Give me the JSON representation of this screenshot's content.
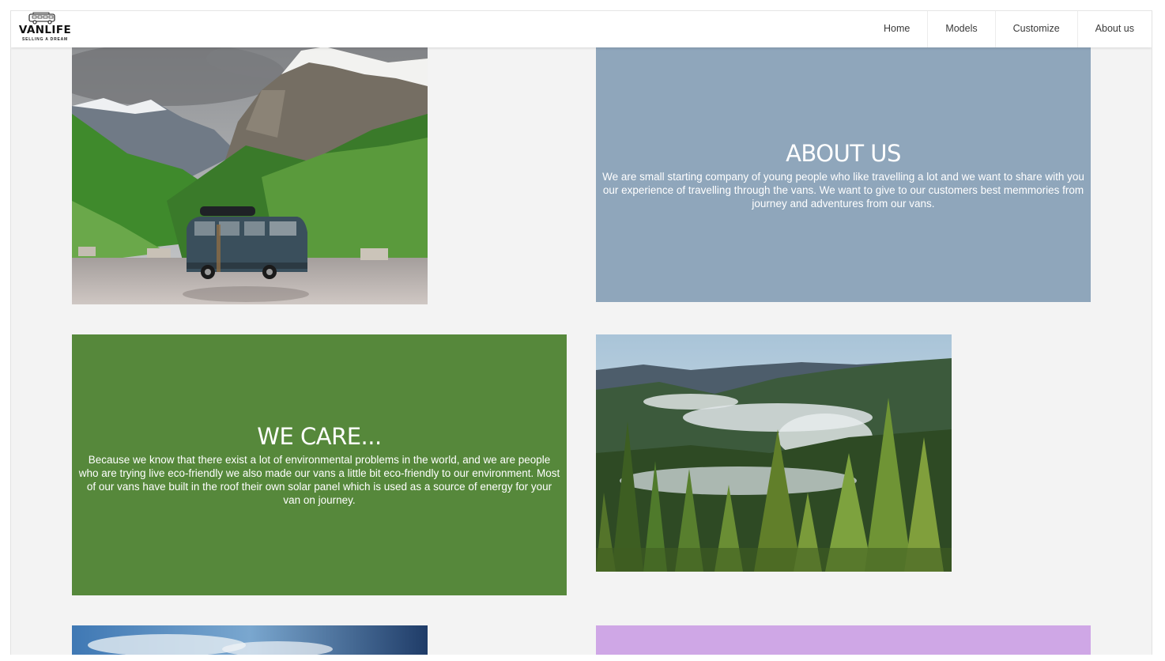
{
  "brand": {
    "name": "VANLIFE",
    "tagline": "SELLING A DREAM",
    "icon": "van-icon"
  },
  "nav": {
    "items": [
      {
        "label": "Home"
      },
      {
        "label": "Models"
      },
      {
        "label": "Customize"
      },
      {
        "label": "About us"
      }
    ]
  },
  "sections": {
    "about": {
      "title": "ABOUT US",
      "body": "We are small starting company of young people who like travelling a lot and we want to share with you our experience of travelling through the vans. We want to give to our customers best memmories from journey and adventures from our vans.",
      "background": "#8fa6bb"
    },
    "care": {
      "title": "WE CARE...",
      "body": "Because we know that there exist a lot of environmental problems in the world, and we are people who are trying live eco-friendly we also made our vans a little bit eco-friendly to our environment. Most of our vans have built in the roof their own solar panel which is used as a source of energy for your van on journey.",
      "background": "#56883b"
    },
    "third": {
      "background": "#cfa7e6"
    }
  },
  "colors": {
    "page_background": "#f3f3f3",
    "navbar_background": "#ffffff",
    "text_on_tiles": "#ffffff"
  }
}
